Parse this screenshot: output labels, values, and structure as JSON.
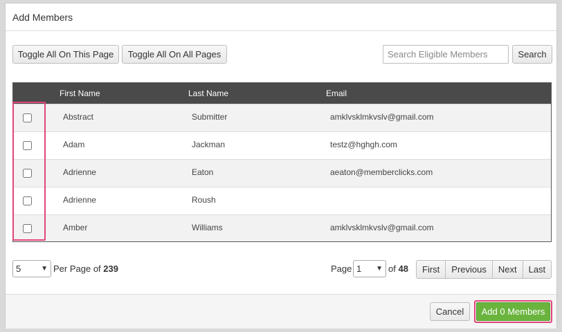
{
  "modal": {
    "title": "Add Members"
  },
  "toolbar": {
    "toggle_page_label": "Toggle All On This Page",
    "toggle_all_label": "Toggle All On All Pages",
    "search_placeholder": "Search Eligible Members",
    "search_label": "Search"
  },
  "table": {
    "headers": {
      "first_name": "First Name",
      "last_name": "Last Name",
      "email": "Email"
    },
    "rows": [
      {
        "first": "Abstract",
        "last": "Submitter",
        "email": "amklvsklmkvslv@gmail.com",
        "checked": false
      },
      {
        "first": "Adam",
        "last": "Jackman",
        "email": "testz@hghgh.com",
        "checked": false
      },
      {
        "first": "Adrienne",
        "last": "Eaton",
        "email": "aeaton@memberclicks.com",
        "checked": false
      },
      {
        "first": "Adrienne",
        "last": "Roush",
        "email": "",
        "checked": false
      },
      {
        "first": "Amber",
        "last": "Williams",
        "email": "amklvsklmkvslv@gmail.com",
        "checked": false
      }
    ]
  },
  "pager": {
    "per_page_value": "5",
    "per_page_text": "Per Page of",
    "total_count": "239",
    "page_label": "Page",
    "current_page": "1",
    "of_label": "of",
    "total_pages": "48",
    "first_label": "First",
    "previous_label": "Previous",
    "next_label": "Next",
    "last_label": "Last"
  },
  "footer": {
    "cancel_label": "Cancel",
    "add_label": "Add 0 Members"
  },
  "colors": {
    "add_button": "#6ab43e",
    "highlight": "#e0457b",
    "table_header": "#4a4a4a"
  },
  "icons": {
    "select_arrow": "chevron-down-icon"
  }
}
